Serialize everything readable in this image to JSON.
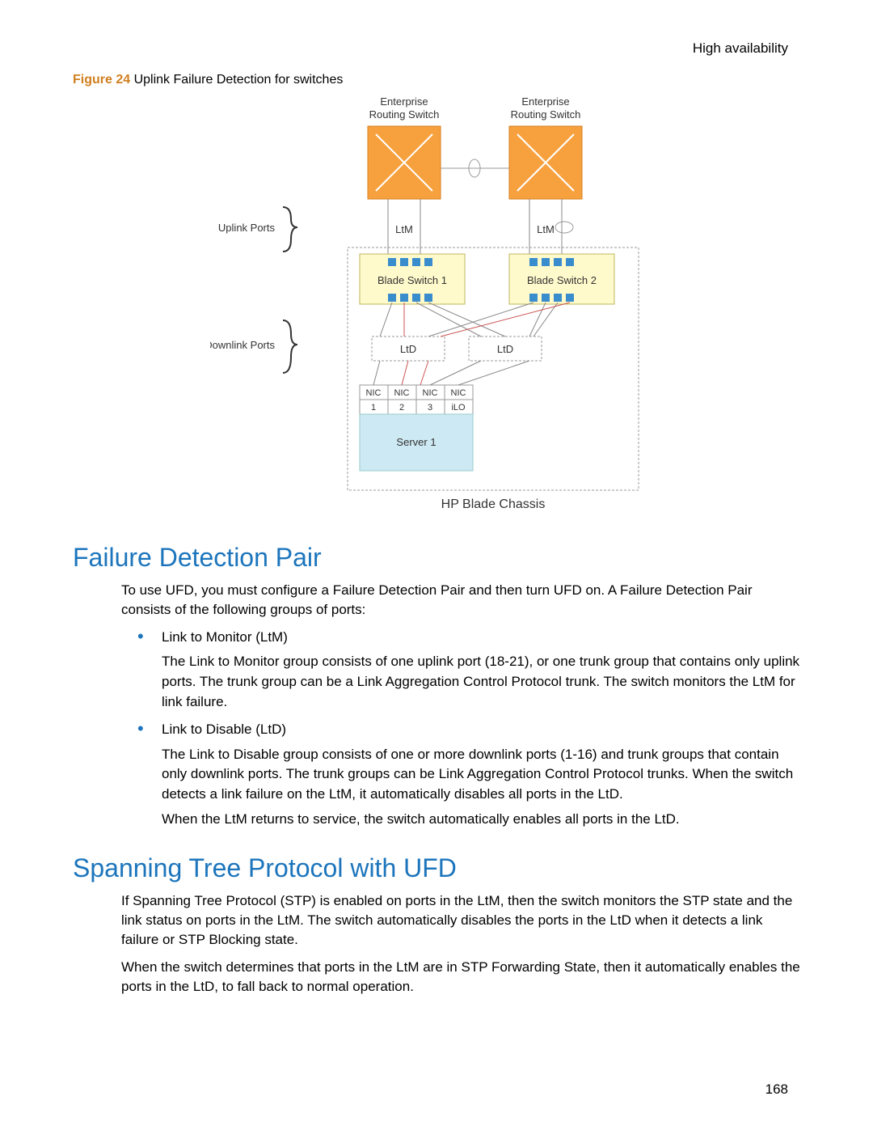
{
  "header": {
    "right": "High availability"
  },
  "figure": {
    "label": "Figure 24",
    "caption": " Uplink Failure Detection for switches",
    "labels": {
      "ers1": "Enterprise",
      "ers1b": "Routing Switch",
      "ers2": "Enterprise",
      "ers2b": "Routing Switch",
      "uplink_ports": "Uplink Ports",
      "downlink_ports": "Downlink Ports",
      "ltm1": "LtM",
      "ltm2": "LtM",
      "blade1": "Blade Switch 1",
      "blade2": "Blade Switch 2",
      "ltd1": "LtD",
      "ltd2": "LtD",
      "nic1": "NIC",
      "nic2": "NIC",
      "nic3": "NIC",
      "nic4": "NIC",
      "n1": "1",
      "n2": "2",
      "n3": "3",
      "nilo": "iLO",
      "server": "Server 1",
      "chassis": "HP Blade Chassis"
    }
  },
  "section1": {
    "title": "Failure Detection Pair",
    "intro": "To use UFD, you must configure a Failure Detection Pair and then turn UFD on. A Failure Detection Pair consists of the following groups of ports:",
    "bullets": [
      {
        "title": "Link to Monitor (LtM)",
        "text": "The Link to Monitor group consists of one uplink port (18-21), or one trunk group that contains only uplink ports. The trunk group can be a Link Aggregation Control Protocol trunk. The switch monitors the LtM for link failure."
      },
      {
        "title": "Link to Disable (LtD)",
        "text": "The Link to Disable group consists of one or more downlink ports (1-16) and trunk groups that contain only downlink ports. The trunk groups can be Link Aggregation Control Protocol trunks. When the switch detects a link failure on the LtM, it automatically disables all ports in the LtD.",
        "text2": "When the LtM returns to service, the switch automatically enables all ports in the LtD."
      }
    ]
  },
  "section2": {
    "title": "Spanning Tree Protocol with UFD",
    "p1": "If Spanning Tree Protocol (STP) is enabled on ports in the LtM, then the switch monitors the STP state and the link status on ports in the LtM. The switch automatically disables the ports in the LtD when it detects a link failure or STP Blocking state.",
    "p2": "When the switch determines that ports in the LtM are in STP Forwarding State, then it automatically enables the ports in the LtD, to fall back to normal operation."
  },
  "page_number": "168"
}
